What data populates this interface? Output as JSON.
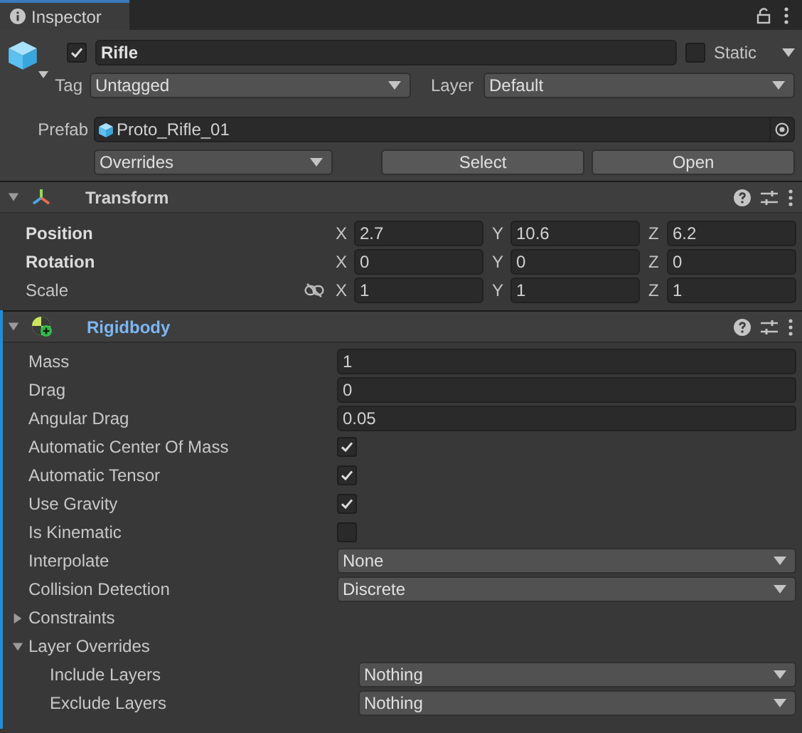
{
  "tab": {
    "title": "Inspector",
    "selected": true
  },
  "object": {
    "active": true,
    "name": "Rifle",
    "static": false,
    "static_label": "Static",
    "tag_label": "Tag",
    "tag": "Untagged",
    "layer_label": "Layer",
    "layer": "Default"
  },
  "prefab": {
    "label": "Prefab",
    "asset": "Proto_Rifle_01",
    "overrides": "Overrides",
    "buttons": [
      "Select",
      "Open"
    ]
  },
  "transform": {
    "title": "Transform",
    "expanded": true,
    "rows": [
      {
        "label": "Position",
        "overridden": true,
        "values": [
          {
            "axis": "X",
            "value": "2.7"
          },
          {
            "axis": "Y",
            "value": "10.6"
          },
          {
            "axis": "Z",
            "value": "6.2"
          }
        ]
      },
      {
        "label": "Rotation",
        "overridden": true,
        "values": [
          {
            "axis": "X",
            "value": "0"
          },
          {
            "axis": "Y",
            "value": "0"
          },
          {
            "axis": "Z",
            "value": "0"
          }
        ]
      },
      {
        "label": "Scale",
        "overridden": false,
        "proportional": false,
        "values": [
          {
            "axis": "X",
            "value": "1"
          },
          {
            "axis": "Y",
            "value": "1"
          },
          {
            "axis": "Z",
            "value": "1"
          }
        ]
      }
    ]
  },
  "rigidbody": {
    "title": "Rigidbody",
    "expanded": true,
    "added": true,
    "properties": [
      {
        "kind": "field",
        "label": "Mass",
        "value": "1"
      },
      {
        "kind": "field",
        "label": "Drag",
        "value": "0"
      },
      {
        "kind": "field",
        "label": "Angular Drag",
        "value": "0.05"
      },
      {
        "kind": "checkbox",
        "label": "Automatic Center Of Mass",
        "checked": true
      },
      {
        "kind": "checkbox",
        "label": "Automatic Tensor",
        "checked": true
      },
      {
        "kind": "checkbox",
        "label": "Use Gravity",
        "checked": true
      },
      {
        "kind": "checkbox",
        "label": "Is Kinematic",
        "checked": false
      },
      {
        "kind": "dropdown",
        "label": "Interpolate",
        "value": "None"
      },
      {
        "kind": "dropdown",
        "label": "Collision Detection",
        "value": "Discrete"
      },
      {
        "kind": "foldout",
        "label": "Constraints",
        "expanded": false
      },
      {
        "kind": "foldout",
        "label": "Layer Overrides",
        "expanded": true,
        "children": [
          {
            "kind": "dropdown",
            "label": "Include Layers",
            "value": "Nothing"
          },
          {
            "kind": "dropdown",
            "label": "Exclude Layers",
            "value": "Nothing"
          }
        ]
      }
    ]
  }
}
